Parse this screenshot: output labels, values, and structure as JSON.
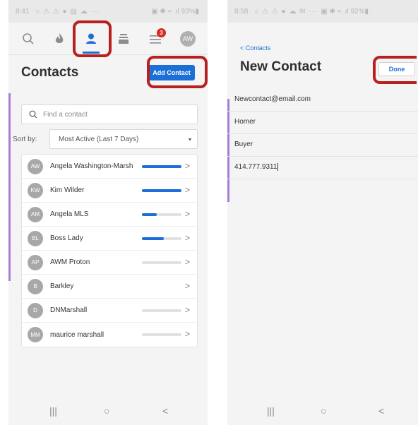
{
  "left_screen": {
    "status": {
      "time": "8:41",
      "icons": "○ ⚠ ⚠ ● ▤ ☁ ···",
      "right": "▣ ✱ ≈ .ıl 93%▮"
    },
    "tabs": [
      {
        "name": "search-tab",
        "icon": "search-icon"
      },
      {
        "name": "hot-tab",
        "icon": "flame-icon"
      },
      {
        "name": "contacts-tab",
        "icon": "person-icon",
        "active": true
      },
      {
        "name": "stack-tab",
        "icon": "layers-icon"
      },
      {
        "name": "menu-tab",
        "icon": "menu-icon",
        "badge": "3"
      },
      {
        "name": "profile-tab",
        "icon": "avatar",
        "initials": "AW"
      }
    ],
    "title": "Contacts",
    "add_button_label": "Add Contact",
    "search_placeholder": "Find a contact",
    "sort_label": "Sort by:",
    "sort_value": "Most Active (Last 7 Days)",
    "contacts": [
      {
        "initials": "AW",
        "name": "Angela Washington-Marsh",
        "activity": 1.0,
        "has_bar": true
      },
      {
        "initials": "KW",
        "name": "Kim Wilder",
        "activity": 1.0,
        "has_bar": true
      },
      {
        "initials": "AM",
        "name": "Angela MLS",
        "activity": 0.38,
        "has_bar": true
      },
      {
        "initials": "BL",
        "name": "Boss Lady",
        "activity": 0.55,
        "has_bar": true
      },
      {
        "initials": "AP",
        "name": "AWM Proton",
        "activity": 0,
        "has_bar": true
      },
      {
        "initials": "B",
        "name": "Barkley",
        "activity": 0,
        "has_bar": false
      },
      {
        "initials": "D",
        "name": "DNMarshall",
        "activity": 0,
        "has_bar": true
      },
      {
        "initials": "MM",
        "name": "maurice marshall",
        "activity": 0,
        "has_bar": true
      }
    ],
    "nav": {
      "recent": "|||",
      "home": "○",
      "back": "<"
    }
  },
  "right_screen": {
    "status": {
      "time": "8:58",
      "icons": "○ ⚠ ⚠ ● ☁ ✉ ···",
      "right": "▣ ✱ ≈ .ıl 92%▮"
    },
    "back_label": "< Contacts",
    "title": "New Contact",
    "done_label": "Done",
    "fields": [
      {
        "name": "email-field",
        "value": "Newcontact@email.com"
      },
      {
        "name": "first-name-field",
        "value": "Homer"
      },
      {
        "name": "last-name-field",
        "value": "Buyer"
      },
      {
        "name": "phone-field",
        "value": "414.777.9311"
      }
    ],
    "nav": {
      "recent": "|||",
      "home": "○",
      "back": "<"
    }
  },
  "colors": {
    "accent": "#1c6fd6",
    "highlight": "#b81f1f",
    "side_accent": "#a77ed6",
    "badge": "#d62a1e"
  }
}
